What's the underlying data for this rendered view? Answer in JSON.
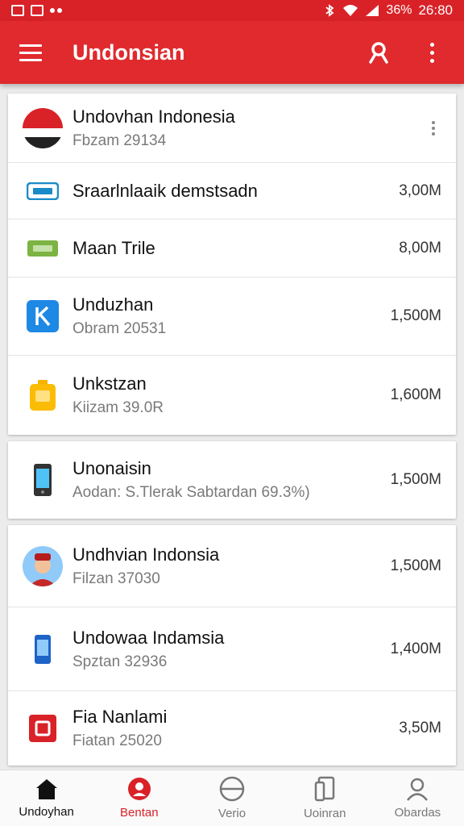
{
  "status_bar": {
    "battery": "36%",
    "time": "26:80"
  },
  "app_bar": {
    "title": "Undonsian"
  },
  "colors": {
    "primary": "#e02a2e",
    "accent": "#d92228"
  },
  "cards": [
    {
      "items": [
        {
          "icon": "indonesia-flag-avatar",
          "title": "Undovhan Indonesia",
          "subtitle": "Fbzam 29134",
          "size": ""
        },
        {
          "icon": "card-icon",
          "title": "Sraarlnlaaik demstsadn",
          "subtitle": "",
          "size": "3,00M"
        },
        {
          "icon": "sim-icon",
          "title": "Maan Trile",
          "subtitle": "",
          "size": "8,00M"
        },
        {
          "icon": "app-k-icon",
          "title": "Unduzhan",
          "subtitle": "Obram 20531",
          "size": "1,500M"
        },
        {
          "icon": "battery-icon",
          "title": "Unkstzan",
          "subtitle": "Kiizam 39.0R",
          "size": "1,600M"
        }
      ]
    },
    {
      "items": [
        {
          "icon": "phone-icon",
          "title": "Unonaisin",
          "subtitle": "Aodan: S.Tlerak Sabtardan 69.3%)",
          "size": "1,500M"
        }
      ]
    },
    {
      "items": [
        {
          "icon": "person-avatar",
          "title": "Undhvian Indonsia",
          "subtitle": "Filzan 37030",
          "size": "1,500M"
        },
        {
          "icon": "mobile-icon",
          "title": "Undowaa Indamsia",
          "subtitle": "Spztan 32936",
          "size": "1,400M"
        },
        {
          "icon": "file-icon",
          "title": "Fia Nanlami",
          "subtitle": "Fiatan 25020",
          "size": "3,50M"
        }
      ]
    }
  ],
  "bottom_nav": [
    {
      "icon": "home-icon",
      "label": "Undoyhan"
    },
    {
      "icon": "profile-icon",
      "label": "Bentan"
    },
    {
      "icon": "circle-icon",
      "label": "Verio"
    },
    {
      "icon": "device-icon",
      "label": "Uoinran"
    },
    {
      "icon": "user-icon",
      "label": "Obardas"
    }
  ]
}
